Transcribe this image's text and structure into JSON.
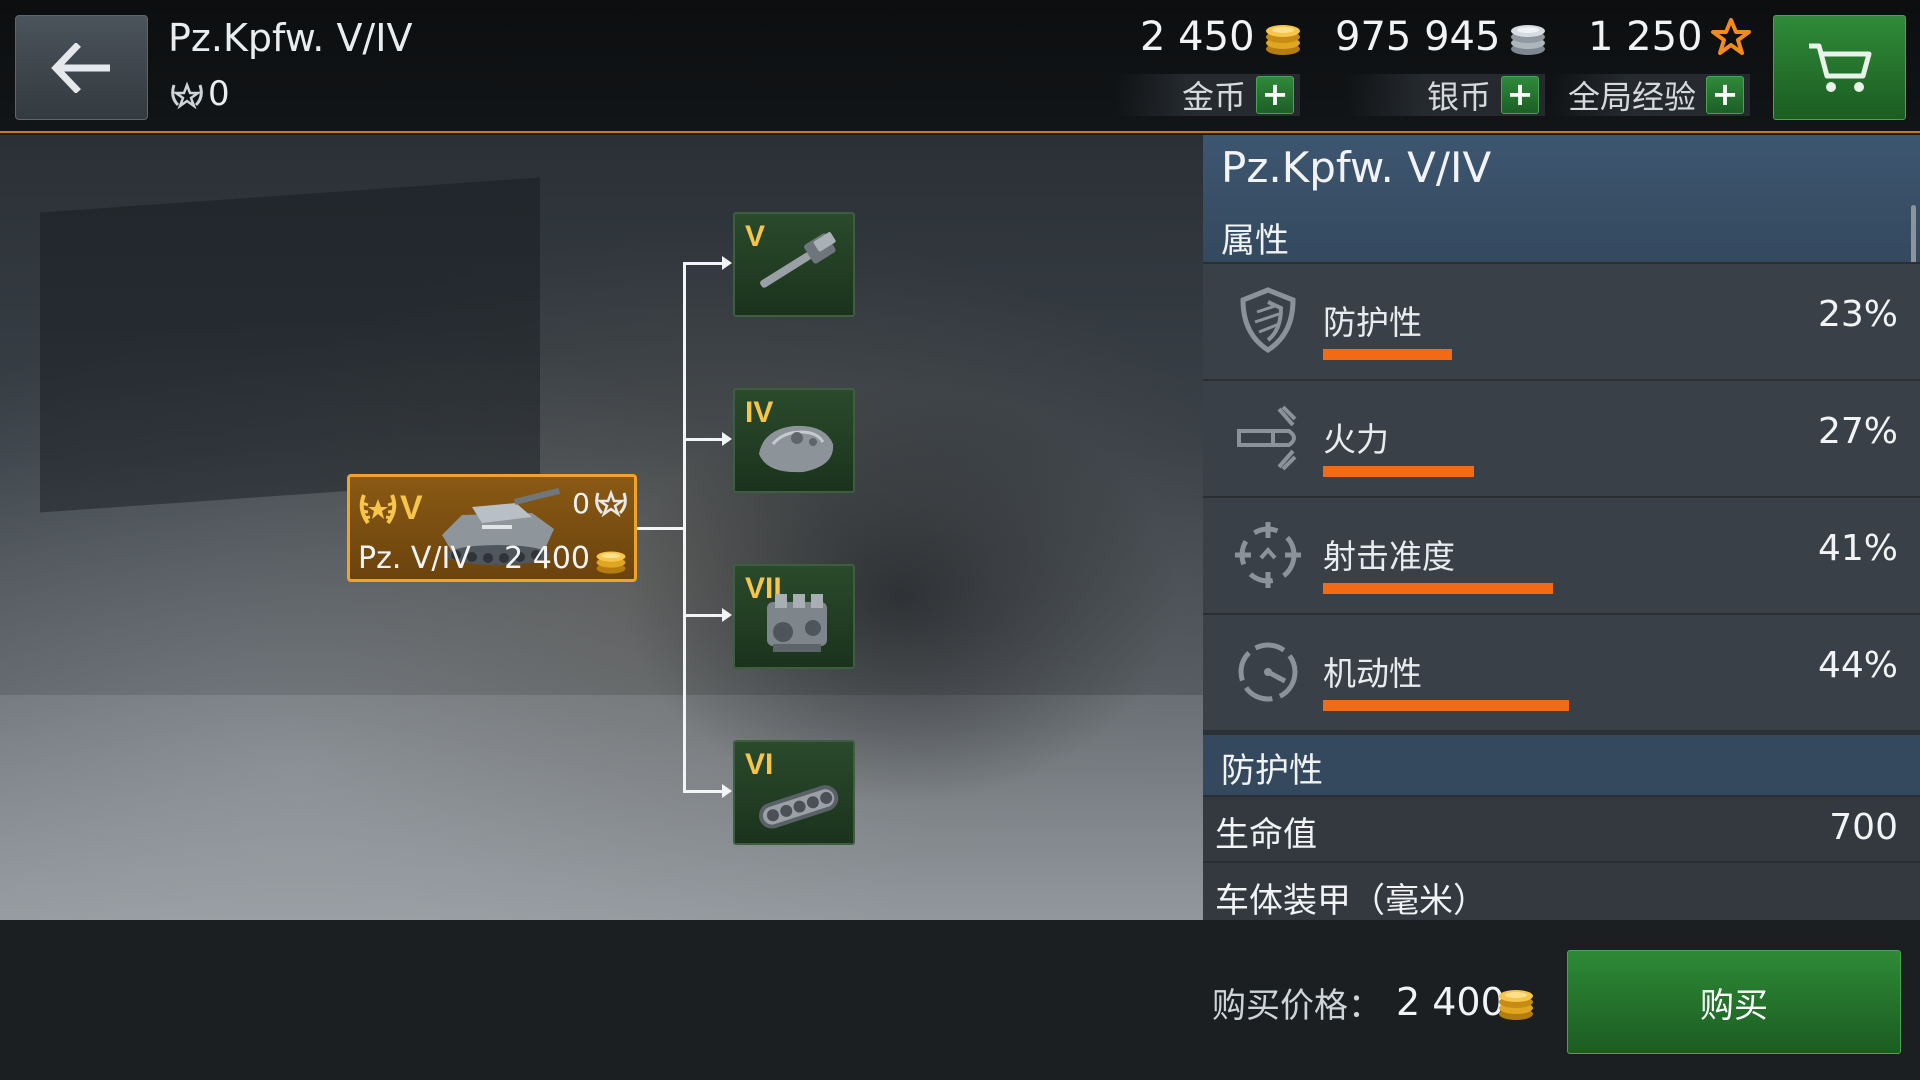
{
  "header": {
    "tank_name": "Pz.Kpfw. V/IV",
    "mastery_value": "0",
    "gold": {
      "amount": "2 450",
      "label": "金币"
    },
    "silver": {
      "amount": "975 945",
      "label": "银币"
    },
    "free_xp": {
      "amount": "1 250",
      "label": "全局经验"
    }
  },
  "tank_card": {
    "tier": "V",
    "mastery_count": "0",
    "name": "Pz. V/IV",
    "price": "2 400"
  },
  "modules": [
    {
      "tier": "V",
      "type": "gun-icon"
    },
    {
      "tier": "IV",
      "type": "turret-icon"
    },
    {
      "tier": "VII",
      "type": "engine-icon"
    },
    {
      "tier": "VI",
      "type": "tracks-icon"
    }
  ],
  "panel": {
    "title": "Pz.Kpfw. V/IV",
    "subtitle": "属性",
    "stats": [
      {
        "name": "防护性",
        "value": "23%",
        "fraction": 0.23,
        "icon": "shield-icon"
      },
      {
        "name": "火力",
        "value": "27%",
        "fraction": 0.27,
        "icon": "shell-icon"
      },
      {
        "name": "射击准度",
        "value": "41%",
        "fraction": 0.41,
        "icon": "crosshair-icon"
      },
      {
        "name": "机动性",
        "value": "44%",
        "fraction": 0.44,
        "icon": "speedometer-icon"
      }
    ],
    "section_title": "防护性",
    "properties": [
      {
        "key": "生命值",
        "value": "700"
      },
      {
        "key": "车体装甲（毫米）",
        "value": ""
      }
    ]
  },
  "bottom": {
    "price_label": "购买价格：",
    "price_value": "2 400",
    "buy_label": "购买"
  },
  "colors": {
    "accent_orange": "#f26a13",
    "gold_text": "#f6c54a",
    "button_green": "#2d8a36",
    "panel_blue": "#34495e"
  }
}
